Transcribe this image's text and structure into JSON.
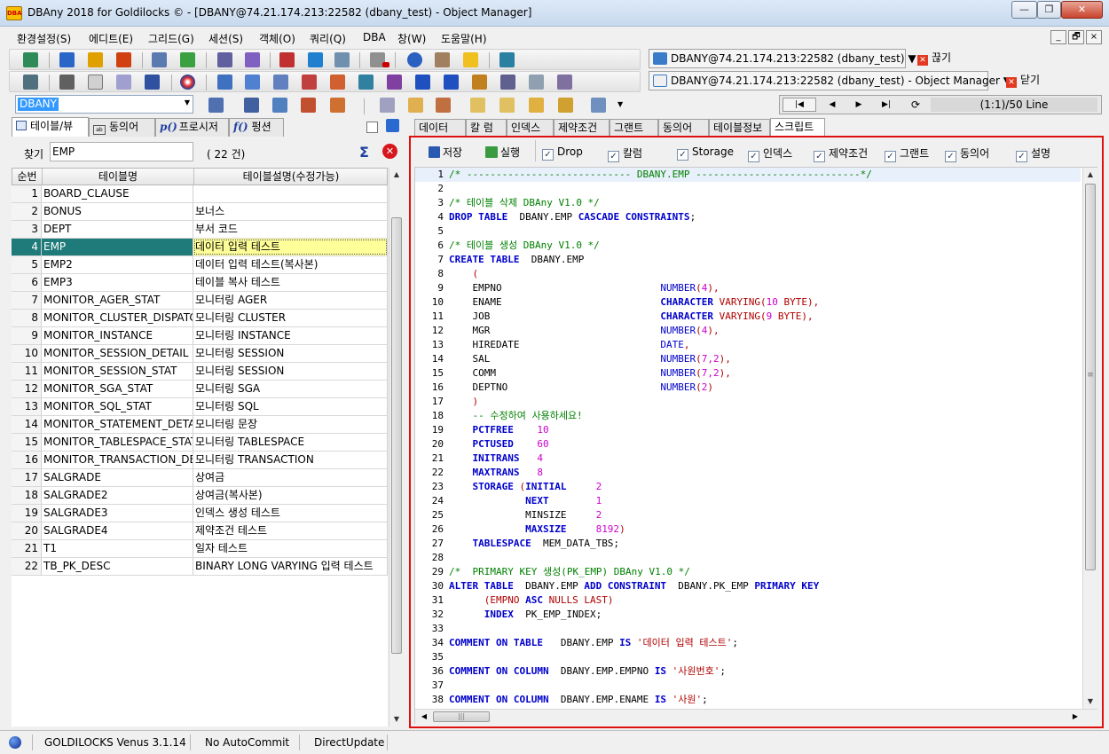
{
  "window": {
    "title": "DBAny 2018 for Goldilocks © - [DBANY@74.21.174.213:22582 (dbany_test) - Object Manager]",
    "app_icon_text": "DBA",
    "min_glyph": "—",
    "restore_glyph": "❐",
    "close_glyph": "✕"
  },
  "menu": {
    "items": [
      "환경설정(S)",
      "에디트(E)",
      "그리드(G)",
      "세션(S)",
      "객체(O)",
      "쿼리(Q)",
      "DBA",
      "창(W)",
      "도움말(H)"
    ],
    "mdi": {
      "min": "_",
      "restore": "🗗",
      "close": "×"
    }
  },
  "toolbar": {
    "connection_label": "DBANY@74.21.174.213:22582 (dbany_test) ▼",
    "disconnect_label": "끊기",
    "object_manager_label": "DBANY@74.21.174.213:22582 (dbany_test) - Object Manager ▼",
    "close_label": "닫기",
    "schema_select": "DBANY",
    "nav_first": "|◀",
    "nav_prev": "◀",
    "nav_next": "▶",
    "nav_last": "▶|",
    "line_info": "(1:1)/50 Line"
  },
  "left_panel": {
    "tabs": [
      "테이블/뷰",
      "동의어",
      "프로시저",
      "펑션"
    ],
    "search_label": "찾기",
    "search_value": "EMP",
    "count_text": "( 22 건)",
    "sigma": "Σ",
    "columns": [
      "순번",
      "테이블명",
      "테이블설명(수정가능)"
    ],
    "selected_row": 4,
    "rows": [
      {
        "no": "1",
        "name": "BOARD_CLAUSE",
        "desc": ""
      },
      {
        "no": "2",
        "name": "BONUS",
        "desc": "보너스"
      },
      {
        "no": "3",
        "name": "DEPT",
        "desc": "부서 코드"
      },
      {
        "no": "4",
        "name": "EMP",
        "desc": "데이터 입력 테스트"
      },
      {
        "no": "5",
        "name": "EMP2",
        "desc": "데이터 입력 테스트(복사본)"
      },
      {
        "no": "6",
        "name": "EMP3",
        "desc": "테이블 복사 테스트"
      },
      {
        "no": "7",
        "name": "MONITOR_AGER_STAT",
        "desc": "모니터링 AGER"
      },
      {
        "no": "8",
        "name": "MONITOR_CLUSTER_DISPATCH",
        "desc": "모니터링 CLUSTER"
      },
      {
        "no": "9",
        "name": "MONITOR_INSTANCE",
        "desc": "모니터링 INSTANCE"
      },
      {
        "no": "10",
        "name": "MONITOR_SESSION_DETAIL",
        "desc": "모니터링 SESSION"
      },
      {
        "no": "11",
        "name": "MONITOR_SESSION_STAT",
        "desc": "모니터링 SESSION"
      },
      {
        "no": "12",
        "name": "MONITOR_SGA_STAT",
        "desc": "모니터링 SGA"
      },
      {
        "no": "13",
        "name": "MONITOR_SQL_STAT",
        "desc": "모니터링 SQL"
      },
      {
        "no": "14",
        "name": "MONITOR_STATEMENT_DETAIL",
        "desc": "모니터링 문장"
      },
      {
        "no": "15",
        "name": "MONITOR_TABLESPACE_STAT",
        "desc": "모니터링 TABLESPACE"
      },
      {
        "no": "16",
        "name": "MONITOR_TRANSACTION_DETAIL",
        "desc": "모니터링 TRANSACTION"
      },
      {
        "no": "17",
        "name": "SALGRADE",
        "desc": "상여금"
      },
      {
        "no": "18",
        "name": "SALGRADE2",
        "desc": "상여금(복사본)"
      },
      {
        "no": "19",
        "name": "SALGRADE3",
        "desc": "인덱스 생성 테스트"
      },
      {
        "no": "20",
        "name": "SALGRADE4",
        "desc": "제약조건 테스트"
      },
      {
        "no": "21",
        "name": "T1",
        "desc": "일자 테스트"
      },
      {
        "no": "22",
        "name": "TB_PK_DESC",
        "desc": "BINARY LONG VARYING 입력 테스트"
      }
    ]
  },
  "right_panel": {
    "tabs": [
      "데이터",
      "칼 럼",
      "인덱스",
      "제약조건",
      "그랜트",
      "동의어",
      "테이블정보",
      "스크립트"
    ],
    "active_tab": 7,
    "save_label": "저장",
    "run_label": "실행",
    "options": [
      {
        "label": "Drop",
        "checked": true
      },
      {
        "label": "칼럼",
        "checked": true
      },
      {
        "label": "Storage",
        "checked": true
      },
      {
        "label": "인덱스",
        "checked": true
      },
      {
        "label": "제약조건",
        "checked": true
      },
      {
        "label": "그랜트",
        "checked": true
      },
      {
        "label": "동의어",
        "checked": true
      },
      {
        "label": "설명",
        "checked": true
      }
    ]
  },
  "script_lines": [
    [
      [
        "cm",
        "/* ---------------------------- DBANY.EMP ----------------------------*/"
      ]
    ],
    [],
    [
      [
        "cm",
        "/* 테이블 삭제 DBAny V1.0 */"
      ]
    ],
    [
      [
        "kw",
        "DROP TABLE"
      ],
      [
        "",
        "  DBANY.EMP "
      ],
      [
        "kw",
        "CASCADE CONSTRAINTS"
      ],
      [
        "",
        ";"
      ]
    ],
    [],
    [
      [
        "cm",
        "/* 테이블 생성 DBAny V1.0 */"
      ]
    ],
    [
      [
        "kw",
        "CREATE TABLE"
      ],
      [
        "",
        "  DBANY.EMP"
      ]
    ],
    [
      [
        "st",
        "    ("
      ]
    ],
    [
      [
        "",
        "    EMPNO                           "
      ],
      [
        "ty",
        "NUMBER"
      ],
      [
        "st",
        "("
      ],
      [
        "nm",
        "4"
      ],
      [
        "st",
        "),"
      ]
    ],
    [
      [
        "",
        "    ENAME                           "
      ],
      [
        "kw",
        "CHARACTER"
      ],
      [
        "st",
        " VARYING("
      ],
      [
        "nm",
        "10"
      ],
      [
        "st",
        " BYTE),"
      ]
    ],
    [
      [
        "",
        "    JOB                             "
      ],
      [
        "kw",
        "CHARACTER"
      ],
      [
        "st",
        " VARYING("
      ],
      [
        "nm",
        "9"
      ],
      [
        "st",
        " BYTE),"
      ]
    ],
    [
      [
        "",
        "    MGR                             "
      ],
      [
        "ty",
        "NUMBER"
      ],
      [
        "st",
        "("
      ],
      [
        "nm",
        "4"
      ],
      [
        "st",
        "),"
      ]
    ],
    [
      [
        "",
        "    HIREDATE                        "
      ],
      [
        "ty",
        "DATE"
      ],
      [
        "st",
        ","
      ]
    ],
    [
      [
        "",
        "    SAL                             "
      ],
      [
        "ty",
        "NUMBER"
      ],
      [
        "st",
        "("
      ],
      [
        "nm",
        "7,2"
      ],
      [
        "st",
        "),"
      ]
    ],
    [
      [
        "",
        "    COMM                            "
      ],
      [
        "ty",
        "NUMBER"
      ],
      [
        "st",
        "("
      ],
      [
        "nm",
        "7,2"
      ],
      [
        "st",
        "),"
      ]
    ],
    [
      [
        "",
        "    DEPTNO                          "
      ],
      [
        "ty",
        "NUMBER"
      ],
      [
        "st",
        "("
      ],
      [
        "nm",
        "2"
      ],
      [
        "st",
        ")"
      ]
    ],
    [
      [
        "st",
        "    )"
      ]
    ],
    [
      [
        "cm",
        "    -- 수정하여 사용하세요!"
      ]
    ],
    [
      [
        "kw",
        "    PCTFREE"
      ],
      [
        "nm",
        "    10"
      ]
    ],
    [
      [
        "kw",
        "    PCTUSED"
      ],
      [
        "nm",
        "    60"
      ]
    ],
    [
      [
        "kw",
        "    INITRANS"
      ],
      [
        "nm",
        "   4"
      ]
    ],
    [
      [
        "kw",
        "    MAXTRANS"
      ],
      [
        "nm",
        "   8"
      ]
    ],
    [
      [
        "kw",
        "    STORAGE"
      ],
      [
        "st",
        " ("
      ],
      [
        "kw",
        "INITIAL"
      ],
      [
        "nm",
        "     2"
      ]
    ],
    [
      [
        "kw",
        "             NEXT"
      ],
      [
        "nm",
        "        1"
      ]
    ],
    [
      [
        "",
        "             MINSIZE"
      ],
      [
        "nm",
        "     2"
      ]
    ],
    [
      [
        "kw",
        "             MAXSIZE"
      ],
      [
        "nm",
        "     8192"
      ],
      [
        "st",
        ")"
      ]
    ],
    [
      [
        "kw",
        "    TABLESPACE"
      ],
      [
        "",
        "  MEM_DATA_TBS;"
      ]
    ],
    [],
    [
      [
        "cm",
        "/*  PRIMARY KEY 생성(PK_EMP) DBAny V1.0 */"
      ]
    ],
    [
      [
        "kw",
        "ALTER TABLE"
      ],
      [
        "",
        "  DBANY.EMP "
      ],
      [
        "kw",
        "ADD CONSTRAINT"
      ],
      [
        "",
        "  DBANY.PK_EMP "
      ],
      [
        "kw",
        "PRIMARY KEY"
      ]
    ],
    [
      [
        "st",
        "      (EMPNO "
      ],
      [
        "kw",
        "ASC"
      ],
      [
        "st",
        " NULLS LAST)"
      ]
    ],
    [
      [
        "kw",
        "      INDEX"
      ],
      [
        "",
        "  PK_EMP_INDEX;"
      ]
    ],
    [],
    [
      [
        "kw",
        "COMMENT ON TABLE"
      ],
      [
        "",
        "   DBANY.EMP "
      ],
      [
        "kw",
        "IS"
      ],
      [
        "st",
        " '데이터 입력 테스트'"
      ],
      [
        "",
        ";"
      ]
    ],
    [],
    [
      [
        "kw",
        "COMMENT ON COLUMN"
      ],
      [
        "",
        "  DBANY.EMP.EMPNO "
      ],
      [
        "kw",
        "IS"
      ],
      [
        "st",
        " '사원번호'"
      ],
      [
        "",
        ";"
      ]
    ],
    [],
    [
      [
        "kw",
        "COMMENT ON COLUMN"
      ],
      [
        "",
        "  DBANY.EMP.ENAME "
      ],
      [
        "kw",
        "IS"
      ],
      [
        "st",
        " '사원'"
      ],
      [
        "",
        ";"
      ]
    ]
  ],
  "scroll_arrows": {
    "up": "▲",
    "down": "▼",
    "left": "◀",
    "right": "▶",
    "grip": "|||",
    "grip_v": "≡"
  },
  "status": {
    "db": "GOLDILOCKS Venus 3.1.14",
    "commit": "No AutoCommit",
    "update": "DirectUpdate"
  },
  "colors": {
    "accent_red": "#e01010",
    "selection": "#1f7a7a"
  }
}
